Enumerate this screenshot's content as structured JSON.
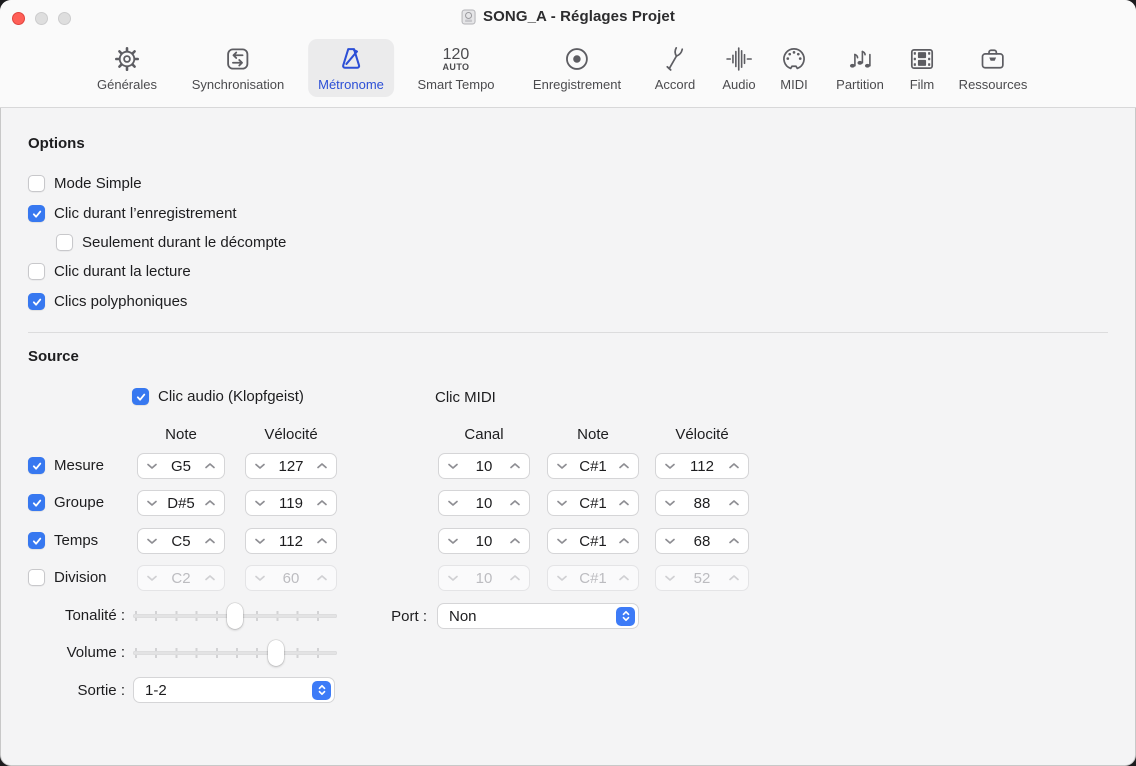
{
  "window": {
    "title": "SONG_A - Réglages Projet"
  },
  "toolbar": {
    "items": [
      {
        "label": "Générales",
        "icon": "gear-icon",
        "selected": false
      },
      {
        "label": "Synchronisation",
        "icon": "sync-icon",
        "selected": false
      },
      {
        "label": "Métronome",
        "icon": "metronome-icon",
        "selected": true
      },
      {
        "label": "Smart Tempo",
        "icon": "smart-tempo-icon",
        "tempo_value": "120",
        "tempo_mode": "AUTO",
        "selected": false
      },
      {
        "label": "Enregistrement",
        "icon": "record-icon",
        "selected": false
      },
      {
        "label": "Accord",
        "icon": "tuning-fork-icon",
        "selected": false
      },
      {
        "label": "Audio",
        "icon": "waveform-icon",
        "selected": false
      },
      {
        "label": "MIDI",
        "icon": "midi-plug-icon",
        "selected": false
      },
      {
        "label": "Partition",
        "icon": "music-notes-icon",
        "selected": false
      },
      {
        "label": "Film",
        "icon": "film-icon",
        "selected": false
      },
      {
        "label": "Ressources",
        "icon": "briefcase-icon",
        "selected": false
      }
    ]
  },
  "options": {
    "heading": "Options",
    "checkboxes": [
      {
        "label": "Mode Simple",
        "checked": false
      },
      {
        "label": "Clic durant l’enregistrement",
        "checked": true
      },
      {
        "label": "Seulement durant le décompte",
        "checked": false,
        "indented": true
      },
      {
        "label": "Clic durant la lecture",
        "checked": false
      },
      {
        "label": "Clics polyphoniques",
        "checked": true
      }
    ]
  },
  "source": {
    "heading": "Source",
    "audio_click": {
      "label": "Clic audio (Klopfgeist)",
      "checked": true
    },
    "midi_click_label": "Clic MIDI",
    "audio_columns": {
      "note": "Note",
      "velocity": "Vélocité"
    },
    "midi_columns": {
      "channel": "Canal",
      "note": "Note",
      "velocity": "Vélocité"
    },
    "rows": [
      {
        "label": "Mesure",
        "checked": true,
        "disabled": false,
        "note": "G5",
        "velocity": "127",
        "midi_channel": "10",
        "midi_note": "C#1",
        "midi_velocity": "112"
      },
      {
        "label": "Groupe",
        "checked": true,
        "disabled": false,
        "note": "D#5",
        "velocity": "119",
        "midi_channel": "10",
        "midi_note": "C#1",
        "midi_velocity": "88"
      },
      {
        "label": "Temps",
        "checked": true,
        "disabled": false,
        "note": "C5",
        "velocity": "112",
        "midi_channel": "10",
        "midi_note": "C#1",
        "midi_velocity": "68"
      },
      {
        "label": "Division",
        "checked": false,
        "disabled": true,
        "note": "C2",
        "velocity": "60",
        "midi_channel": "10",
        "midi_note": "C#1",
        "midi_velocity": "52"
      }
    ],
    "tonality": {
      "label": "Tonalité :",
      "value_percent": 50
    },
    "volume": {
      "label": "Volume :",
      "value_percent": 70
    },
    "output": {
      "label": "Sortie :",
      "value": "1-2"
    },
    "port": {
      "label": "Port :",
      "value": "Non"
    }
  },
  "colors": {
    "accent_blue": "#3778f0",
    "popup_blue": "#3d7bf7",
    "selected_tab_blue": "#2c4fd6",
    "header_bg": "#fafafa",
    "content_bg": "#f4f4f5",
    "close_red": "#ff5f57"
  }
}
